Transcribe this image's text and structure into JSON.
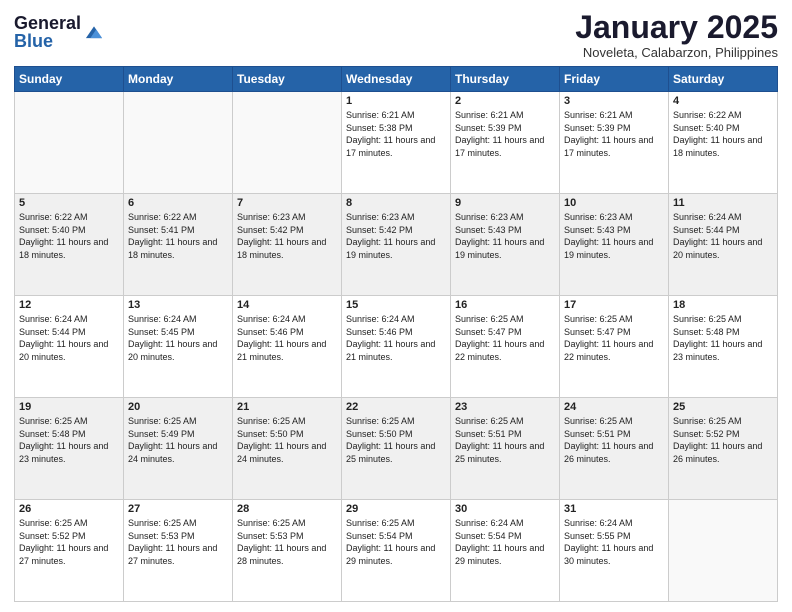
{
  "logo": {
    "general": "General",
    "blue": "Blue"
  },
  "header": {
    "month": "January 2025",
    "location": "Noveleta, Calabarzon, Philippines"
  },
  "weekdays": [
    "Sunday",
    "Monday",
    "Tuesday",
    "Wednesday",
    "Thursday",
    "Friday",
    "Saturday"
  ],
  "weeks": [
    [
      {
        "day": "",
        "sunrise": "",
        "sunset": "",
        "daylight": ""
      },
      {
        "day": "",
        "sunrise": "",
        "sunset": "",
        "daylight": ""
      },
      {
        "day": "",
        "sunrise": "",
        "sunset": "",
        "daylight": ""
      },
      {
        "day": "1",
        "sunrise": "Sunrise: 6:21 AM",
        "sunset": "Sunset: 5:38 PM",
        "daylight": "Daylight: 11 hours and 17 minutes."
      },
      {
        "day": "2",
        "sunrise": "Sunrise: 6:21 AM",
        "sunset": "Sunset: 5:39 PM",
        "daylight": "Daylight: 11 hours and 17 minutes."
      },
      {
        "day": "3",
        "sunrise": "Sunrise: 6:21 AM",
        "sunset": "Sunset: 5:39 PM",
        "daylight": "Daylight: 11 hours and 17 minutes."
      },
      {
        "day": "4",
        "sunrise": "Sunrise: 6:22 AM",
        "sunset": "Sunset: 5:40 PM",
        "daylight": "Daylight: 11 hours and 18 minutes."
      }
    ],
    [
      {
        "day": "5",
        "sunrise": "Sunrise: 6:22 AM",
        "sunset": "Sunset: 5:40 PM",
        "daylight": "Daylight: 11 hours and 18 minutes."
      },
      {
        "day": "6",
        "sunrise": "Sunrise: 6:22 AM",
        "sunset": "Sunset: 5:41 PM",
        "daylight": "Daylight: 11 hours and 18 minutes."
      },
      {
        "day": "7",
        "sunrise": "Sunrise: 6:23 AM",
        "sunset": "Sunset: 5:42 PM",
        "daylight": "Daylight: 11 hours and 18 minutes."
      },
      {
        "day": "8",
        "sunrise": "Sunrise: 6:23 AM",
        "sunset": "Sunset: 5:42 PM",
        "daylight": "Daylight: 11 hours and 19 minutes."
      },
      {
        "day": "9",
        "sunrise": "Sunrise: 6:23 AM",
        "sunset": "Sunset: 5:43 PM",
        "daylight": "Daylight: 11 hours and 19 minutes."
      },
      {
        "day": "10",
        "sunrise": "Sunrise: 6:23 AM",
        "sunset": "Sunset: 5:43 PM",
        "daylight": "Daylight: 11 hours and 19 minutes."
      },
      {
        "day": "11",
        "sunrise": "Sunrise: 6:24 AM",
        "sunset": "Sunset: 5:44 PM",
        "daylight": "Daylight: 11 hours and 20 minutes."
      }
    ],
    [
      {
        "day": "12",
        "sunrise": "Sunrise: 6:24 AM",
        "sunset": "Sunset: 5:44 PM",
        "daylight": "Daylight: 11 hours and 20 minutes."
      },
      {
        "day": "13",
        "sunrise": "Sunrise: 6:24 AM",
        "sunset": "Sunset: 5:45 PM",
        "daylight": "Daylight: 11 hours and 20 minutes."
      },
      {
        "day": "14",
        "sunrise": "Sunrise: 6:24 AM",
        "sunset": "Sunset: 5:46 PM",
        "daylight": "Daylight: 11 hours and 21 minutes."
      },
      {
        "day": "15",
        "sunrise": "Sunrise: 6:24 AM",
        "sunset": "Sunset: 5:46 PM",
        "daylight": "Daylight: 11 hours and 21 minutes."
      },
      {
        "day": "16",
        "sunrise": "Sunrise: 6:25 AM",
        "sunset": "Sunset: 5:47 PM",
        "daylight": "Daylight: 11 hours and 22 minutes."
      },
      {
        "day": "17",
        "sunrise": "Sunrise: 6:25 AM",
        "sunset": "Sunset: 5:47 PM",
        "daylight": "Daylight: 11 hours and 22 minutes."
      },
      {
        "day": "18",
        "sunrise": "Sunrise: 6:25 AM",
        "sunset": "Sunset: 5:48 PM",
        "daylight": "Daylight: 11 hours and 23 minutes."
      }
    ],
    [
      {
        "day": "19",
        "sunrise": "Sunrise: 6:25 AM",
        "sunset": "Sunset: 5:48 PM",
        "daylight": "Daylight: 11 hours and 23 minutes."
      },
      {
        "day": "20",
        "sunrise": "Sunrise: 6:25 AM",
        "sunset": "Sunset: 5:49 PM",
        "daylight": "Daylight: 11 hours and 24 minutes."
      },
      {
        "day": "21",
        "sunrise": "Sunrise: 6:25 AM",
        "sunset": "Sunset: 5:50 PM",
        "daylight": "Daylight: 11 hours and 24 minutes."
      },
      {
        "day": "22",
        "sunrise": "Sunrise: 6:25 AM",
        "sunset": "Sunset: 5:50 PM",
        "daylight": "Daylight: 11 hours and 25 minutes."
      },
      {
        "day": "23",
        "sunrise": "Sunrise: 6:25 AM",
        "sunset": "Sunset: 5:51 PM",
        "daylight": "Daylight: 11 hours and 25 minutes."
      },
      {
        "day": "24",
        "sunrise": "Sunrise: 6:25 AM",
        "sunset": "Sunset: 5:51 PM",
        "daylight": "Daylight: 11 hours and 26 minutes."
      },
      {
        "day": "25",
        "sunrise": "Sunrise: 6:25 AM",
        "sunset": "Sunset: 5:52 PM",
        "daylight": "Daylight: 11 hours and 26 minutes."
      }
    ],
    [
      {
        "day": "26",
        "sunrise": "Sunrise: 6:25 AM",
        "sunset": "Sunset: 5:52 PM",
        "daylight": "Daylight: 11 hours and 27 minutes."
      },
      {
        "day": "27",
        "sunrise": "Sunrise: 6:25 AM",
        "sunset": "Sunset: 5:53 PM",
        "daylight": "Daylight: 11 hours and 27 minutes."
      },
      {
        "day": "28",
        "sunrise": "Sunrise: 6:25 AM",
        "sunset": "Sunset: 5:53 PM",
        "daylight": "Daylight: 11 hours and 28 minutes."
      },
      {
        "day": "29",
        "sunrise": "Sunrise: 6:25 AM",
        "sunset": "Sunset: 5:54 PM",
        "daylight": "Daylight: 11 hours and 29 minutes."
      },
      {
        "day": "30",
        "sunrise": "Sunrise: 6:24 AM",
        "sunset": "Sunset: 5:54 PM",
        "daylight": "Daylight: 11 hours and 29 minutes."
      },
      {
        "day": "31",
        "sunrise": "Sunrise: 6:24 AM",
        "sunset": "Sunset: 5:55 PM",
        "daylight": "Daylight: 11 hours and 30 minutes."
      },
      {
        "day": "",
        "sunrise": "",
        "sunset": "",
        "daylight": ""
      }
    ]
  ]
}
